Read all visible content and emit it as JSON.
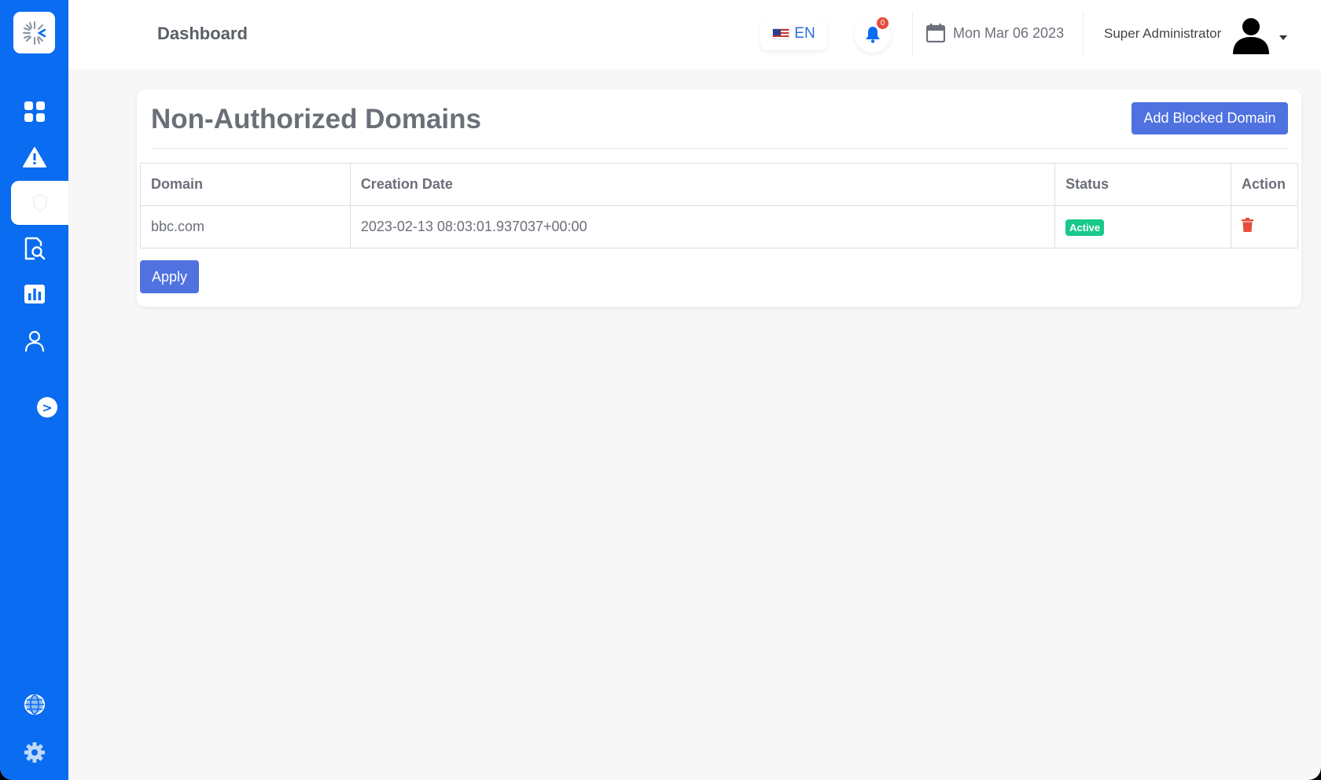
{
  "header": {
    "title": "Dashboard",
    "language": "EN",
    "notifications_count": "0",
    "date": "Mon Mar 06 2023",
    "user_name": "Super Administrator"
  },
  "sidebar": {
    "items": [
      {
        "name": "dashboard",
        "icon": "grid-icon"
      },
      {
        "name": "alerts",
        "icon": "warning-icon"
      },
      {
        "name": "domains",
        "icon": "shield-icon",
        "active": true
      },
      {
        "name": "investigation",
        "icon": "document-search-icon"
      },
      {
        "name": "reports",
        "icon": "bar-chart-icon"
      },
      {
        "name": "users",
        "icon": "user-icon"
      }
    ],
    "collapse_label": ">",
    "bottom_items": [
      {
        "name": "globe",
        "icon": "globe-icon"
      },
      {
        "name": "settings",
        "icon": "gear-icon"
      }
    ]
  },
  "main": {
    "card_title": "Non-Authorized Domains",
    "add_button_label": "Add Blocked Domain",
    "apply_button_label": "Apply",
    "table": {
      "columns": [
        "Domain",
        "Creation Date",
        "Status",
        "Action"
      ],
      "rows": [
        {
          "domain": "bbc.com",
          "creation_date": "2023-02-13 08:03:01.937037+00:00",
          "status": "Active"
        }
      ]
    }
  },
  "colors": {
    "sidebar": "#0a6cf0",
    "primary_button": "#4f72e0",
    "status_active": "#18c98a",
    "delete": "#e74c3c",
    "notification_badge": "#e74c3c"
  }
}
